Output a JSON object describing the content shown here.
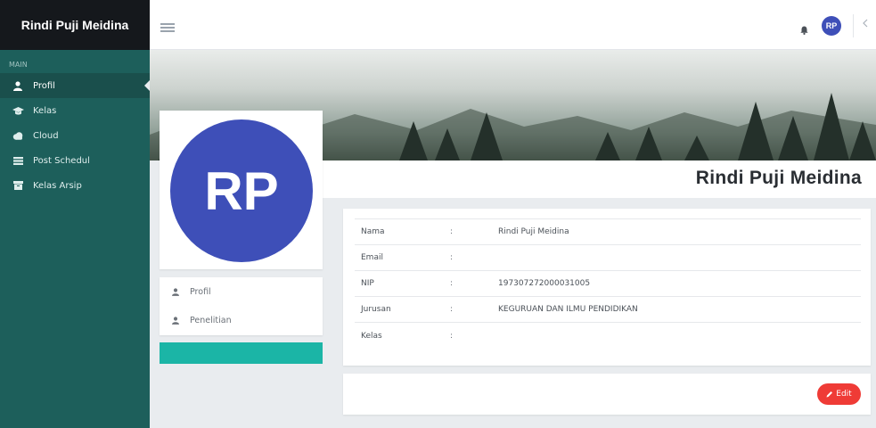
{
  "app": {
    "brand": "Rindi Puji Meidina"
  },
  "sidebar": {
    "section": "MAIN",
    "items": [
      {
        "label": "Profil",
        "icon": "user-icon",
        "active": true
      },
      {
        "label": "Kelas",
        "icon": "graduation-cap-icon"
      },
      {
        "label": "Cloud",
        "icon": "cloud-icon"
      },
      {
        "label": "Post Schedul",
        "icon": "list-icon"
      },
      {
        "label": "Kelas Arsip",
        "icon": "archive-icon"
      }
    ]
  },
  "topbar": {
    "avatar_initials": "RP",
    "icons": [
      "menu-icon",
      "bell-icon",
      "arrow-left-icon"
    ]
  },
  "profile": {
    "name": "Rindi Puji Meidina",
    "initials": "RP",
    "menu": [
      {
        "label": "Profil"
      },
      {
        "label": "Penelitian"
      }
    ]
  },
  "info": {
    "separator": ":",
    "rows": [
      {
        "label": "Nama",
        "value": "Rindi Puji Meidina"
      },
      {
        "label": "Email",
        "value": ""
      },
      {
        "label": "NIP",
        "value": "197307272000031005"
      },
      {
        "label": "Jurusan",
        "value": "KEGURUAN DAN ILMU PENDIDIKAN"
      },
      {
        "label": "Kelas",
        "value": ""
      }
    ]
  },
  "actions": {
    "edit_label": "Edit"
  },
  "colors": {
    "sidebar": "#1d5f5b",
    "brand_bar": "#15181c",
    "avatar": "#3e4fb8",
    "teal": "#1bb5a6",
    "edit": "#ef3b36"
  }
}
